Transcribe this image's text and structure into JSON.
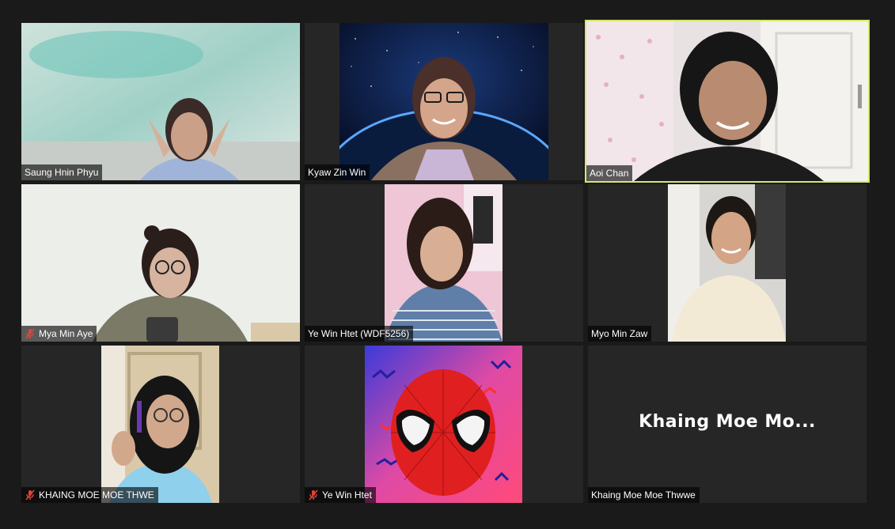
{
  "participants": [
    {
      "name": "Saung Hnin Phyu",
      "muted": false,
      "video": true,
      "active": false
    },
    {
      "name": "Kyaw Zin Win",
      "muted": false,
      "video": true,
      "active": false
    },
    {
      "name": "Aoi Chan",
      "muted": false,
      "video": true,
      "active": true
    },
    {
      "name": "Mya Min Aye",
      "muted": true,
      "video": true,
      "active": false
    },
    {
      "name": "Ye Win Htet (WDF5256)",
      "muted": false,
      "video": true,
      "active": false
    },
    {
      "name": "Myo Min Zaw",
      "muted": false,
      "video": true,
      "active": false
    },
    {
      "name": "KHAING MOE MOE THWE",
      "muted": true,
      "video": true,
      "active": false
    },
    {
      "name": "Ye Win Htet",
      "muted": true,
      "video": true,
      "active": false
    },
    {
      "name": "Khaing Moe Moe Thwwe",
      "muted": false,
      "video": false,
      "active": false,
      "display_name": "Khaing  Moe  Mo..."
    }
  ],
  "colors": {
    "background": "#1a1a1a",
    "tile": "#262626",
    "active_border": "#d6e86a",
    "muted_icon": "#e0453a"
  }
}
